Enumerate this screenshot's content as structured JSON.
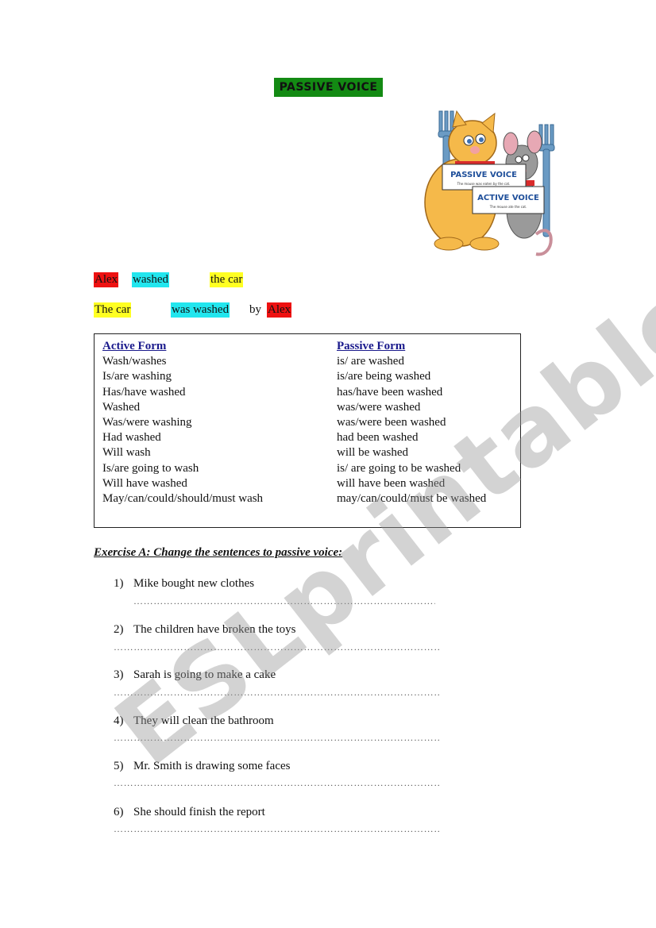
{
  "title": "PASSIVE VOICE",
  "illustration": {
    "sign_passive": "PASSIVE VOICE",
    "sign_passive_caption": "The mouse was eaten by the cat.",
    "sign_active": "ACTIVE VOICE",
    "sign_active_caption": "The mouse ate the cat."
  },
  "example_active": [
    {
      "text": "Alex",
      "color": "red"
    },
    {
      "text": "washed",
      "color": "cyan"
    },
    {
      "text": "the car",
      "color": "yellow"
    }
  ],
  "example_passive": [
    {
      "text": "The car",
      "color": "yellow"
    },
    {
      "text": "was washed",
      "color": "cyan"
    },
    {
      "text": "by",
      "color": "none"
    },
    {
      "text": "Alex",
      "color": "red"
    }
  ],
  "table": {
    "active_header": "Active Form",
    "passive_header": "Passive Form",
    "active": [
      "Wash/washes",
      "Is/are washing",
      "Has/have washed",
      "Washed",
      "Was/were washing",
      "Had washed",
      "Will wash",
      "Is/are going to wash",
      "Will have washed",
      "May/can/could/should/must wash"
    ],
    "passive": [
      "is/ are washed",
      "is/are being washed",
      "has/have been washed",
      "was/were washed",
      "was/were been washed",
      "had been washed",
      "will be washed",
      "is/ are going to be washed",
      "will have been washed",
      "may/can/could/must be washed"
    ]
  },
  "exercise": {
    "title": "Exercise A: Change the sentences to passive voice:",
    "items": [
      {
        "num": "1)",
        "text": "Mike bought new clothes"
      },
      {
        "num": "2)",
        "text": "The children have broken the toys"
      },
      {
        "num": "3)",
        "text": "Sarah is going to make a cake"
      },
      {
        "num": "4)",
        "text": "They will clean the bathroom"
      },
      {
        "num": "5)",
        "text": "Mr. Smith is drawing some faces"
      },
      {
        "num": "6)",
        "text": "She should finish the report"
      }
    ],
    "answer_line": "……………………………………………………………………………………………………………………."
  },
  "watermark": "ESLprintables.com",
  "colors": {
    "title_bg": "#138a13",
    "red": "#ee1111",
    "cyan": "#22e6ee",
    "yellow": "#ffff22",
    "header_blue": "#1a1a8c"
  }
}
